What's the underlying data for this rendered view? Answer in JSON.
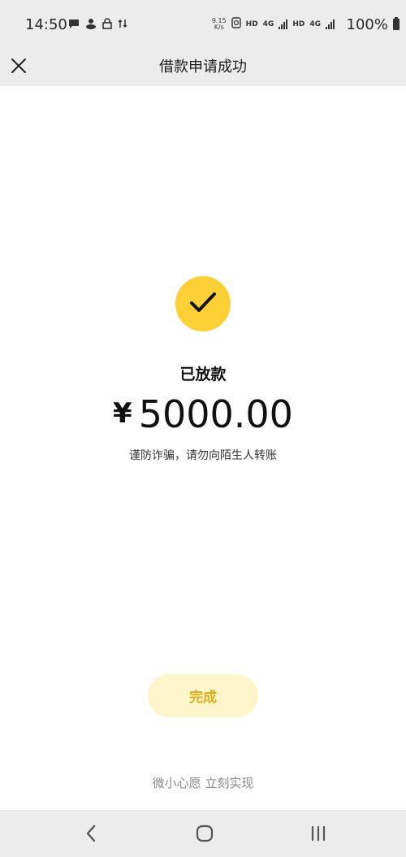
{
  "statusbar": {
    "time": "14:50",
    "speed_value": "9.15",
    "speed_unit": "K/s",
    "hd1": "HD",
    "net1": "4G",
    "hd2": "HD",
    "net2": "4G",
    "battery_percent": "100%"
  },
  "header": {
    "title": "借款申请成功"
  },
  "result": {
    "status": "已放款",
    "currency_symbol": "¥",
    "amount": "5000.00",
    "warning": "谨防诈骗，请勿向陌生人转账"
  },
  "actions": {
    "done_label": "完成"
  },
  "footer": {
    "slogan": "微小心愿 立刻实现"
  },
  "colors": {
    "accent": "#fdd036",
    "button_bg": "#fff5cb",
    "button_text": "#e0ae1d",
    "chrome_bg": "#ececec"
  },
  "icons": {
    "close": "close-icon",
    "success": "check-icon",
    "nav_back": "back-icon",
    "nav_home": "home-icon",
    "nav_recents": "recents-icon"
  }
}
